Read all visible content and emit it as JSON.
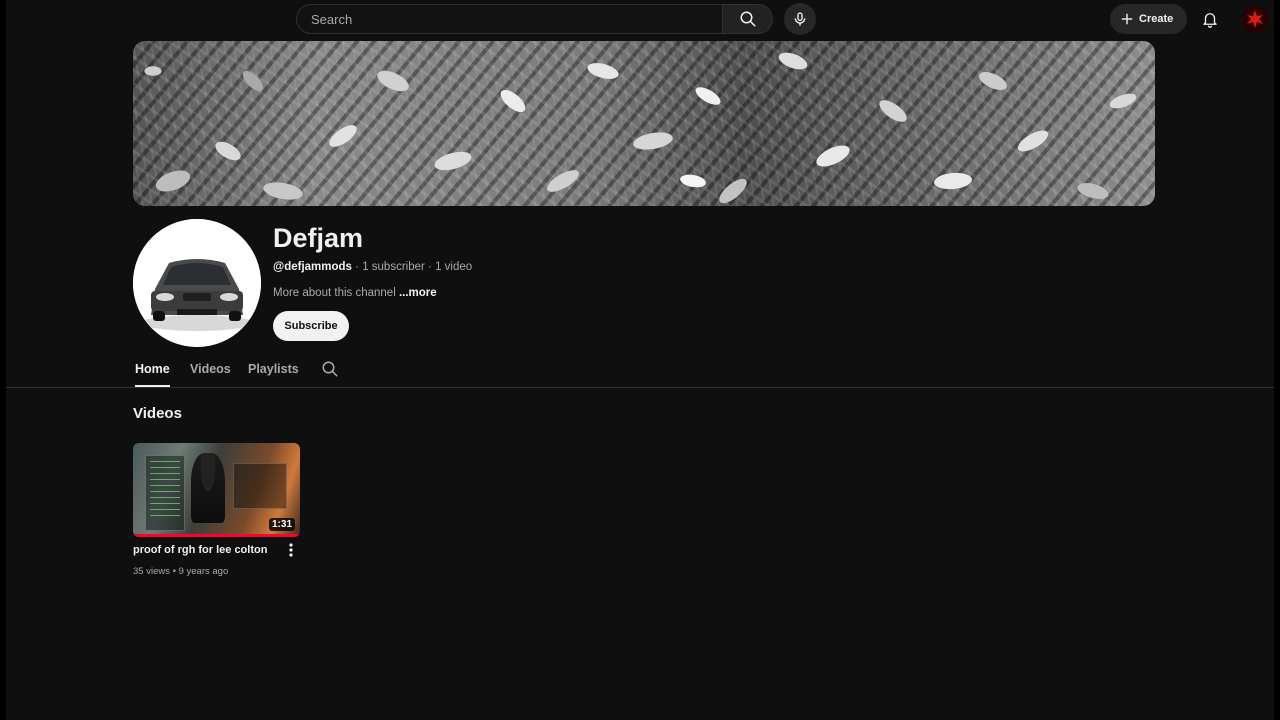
{
  "header": {
    "search_placeholder": "Search",
    "create_label": "Create"
  },
  "channel": {
    "name": "Defjam",
    "handle": "@defjammods",
    "subscribers": "1 subscriber",
    "video_count": "1 video",
    "separator": " · ",
    "description": "More about this channel",
    "more_label": "...more",
    "subscribe_label": "Subscribe"
  },
  "tabs": [
    {
      "label": "Home",
      "active": true
    },
    {
      "label": "Videos",
      "active": false
    },
    {
      "label": "Playlists",
      "active": false
    }
  ],
  "videos_section": {
    "title": "Videos",
    "items": [
      {
        "title": "proof of rgh for lee colton",
        "duration": "1:31",
        "views": "35 views",
        "age": "9 years ago",
        "dot": " • ",
        "watched_fraction": 1.0
      }
    ]
  },
  "colors": {
    "background": "#0f0f0f",
    "text_primary": "#f1f1f1",
    "text_secondary": "#aaaaaa",
    "progress_red": "#ff0033",
    "divider": "#303030"
  },
  "icons": {
    "search": "search-icon",
    "mic": "mic-icon",
    "create": "plus-icon",
    "bell": "bell-icon",
    "tab_search": "search-icon",
    "video_menu": "more-vert-icon"
  }
}
